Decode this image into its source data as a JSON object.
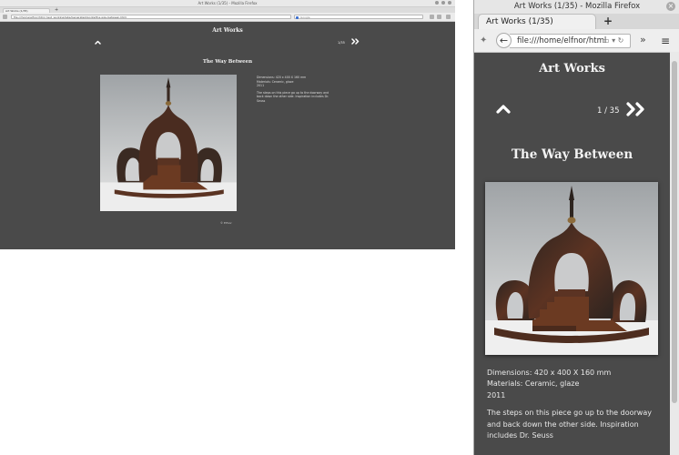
{
  "wide": {
    "window_title": "Art Works (1/35) - Mozilla Firefox",
    "tab_title": "Art Works (1/35)",
    "url": "file:///home/elfnor/html_test_working/labs/Generated/works/the-way-between.html",
    "search_placeholder": "Google",
    "site_title": "Art Works",
    "counter": "1/35",
    "work_title": "The Way Between",
    "dimensions": "Dimensions: 420 x 400 X 160 mm",
    "materials": "Materials: Ceramic, glaze",
    "year": "2011",
    "description": "The steps on this piece go up to the doorway and back down the other side. Inspiration includes Dr. Seuss",
    "copyright": "© Elfnor"
  },
  "narrow": {
    "window_title": "Art Works (1/35) - Mozilla Firefox",
    "tab_title": "Art Works (1/35)",
    "new_tab": "+",
    "url": "file:///home/elfnor/html",
    "site_title": "Art Works",
    "counter": "1 / 35",
    "work_title": "The Way Between",
    "dimensions": "Dimensions: 420 x 400 X 160 mm",
    "materials": "Materials: Ceramic, glaze",
    "year": "2011",
    "description_lines": [
      "The steps on this piece go up to the doorway",
      "and back down the other side. Inspiration",
      "includes Dr. Seuss"
    ]
  },
  "icons": {
    "up": "chevron-up-icon",
    "next": "double-chevron-right-icon",
    "back": "back-arrow-icon",
    "menu": "hamburger-menu-icon",
    "overflow": "double-chevron-right-icon",
    "close": "close-icon",
    "addon": "puzzle-icon"
  },
  "colors": {
    "page_background": "#4a4a4a",
    "text": "#f2f2f2",
    "sculpture_dark": "#3b2a22",
    "sculpture_rust": "#6b3a22"
  }
}
